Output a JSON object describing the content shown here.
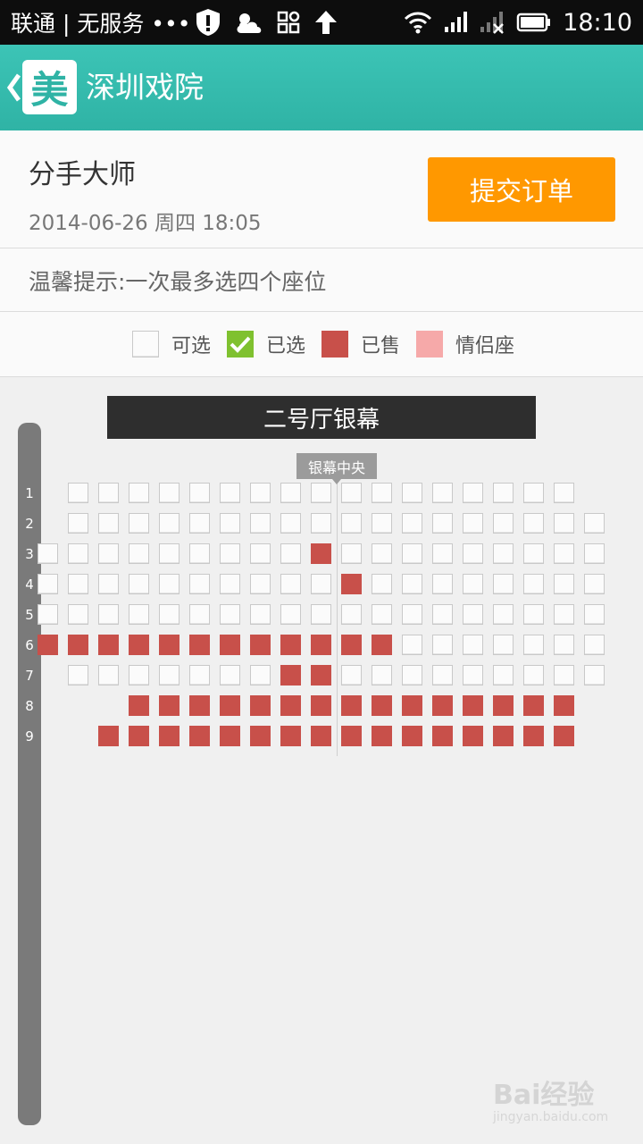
{
  "status_bar": {
    "carrier": "联通 | 无服务 •••",
    "time": "18:10"
  },
  "header": {
    "logo_text": "美",
    "title": "深圳戏院"
  },
  "show": {
    "title": "分手大师",
    "datetime": "2014-06-26 周四 18:05",
    "submit_label": "提交订单"
  },
  "tip": "温馨提示:一次最多选四个座位",
  "legend": [
    {
      "label": "可选",
      "status": "available"
    },
    {
      "label": "已选",
      "status": "selected"
    },
    {
      "label": "已售",
      "status": "sold"
    },
    {
      "label": "情侣座",
      "status": "couple"
    }
  ],
  "colors": {
    "accent": "#2fb3a5",
    "button": "#ff9800",
    "sold": "#c8504a",
    "selected": "#7fc12f",
    "couple": "#f6a9a9"
  },
  "seat_map": {
    "screen_label": "二号厅银幕",
    "center_label": "银幕中央",
    "rows": [
      {
        "label": "1",
        "seats": "-aaaaaaaaaaaaaaaaa-"
      },
      {
        "label": "2",
        "seats": "-aaaaaaaaaaaaaaaaaa"
      },
      {
        "label": "3",
        "seats": "aaaaaaaaasaaaaaaaaa"
      },
      {
        "label": "4",
        "seats": "aaaaaaaaaasaaaaaaaa"
      },
      {
        "label": "5",
        "seats": "aaaaaaaaaaaaaaaaaaa"
      },
      {
        "label": "6",
        "seats": "ssssssssssssaaaaaaa"
      },
      {
        "label": "7",
        "seats": "-aaaaaaassaaaaaaaaa"
      },
      {
        "label": "8",
        "seats": "---sssssssssssssss-"
      },
      {
        "label": "9",
        "seats": "--ssssssssssssssss-"
      }
    ]
  },
  "watermark": {
    "brand": "Bai经验",
    "url": "jingyan.baidu.com"
  }
}
